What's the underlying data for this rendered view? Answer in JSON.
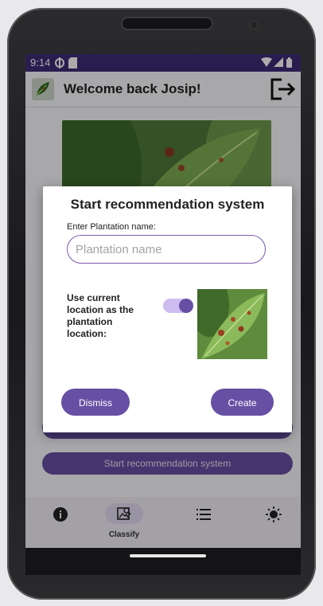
{
  "status_bar": {
    "time": "9:14"
  },
  "app_bar": {
    "title": "Welcome back Josip!"
  },
  "background": {
    "start_button_label": "Start recommendation system"
  },
  "dialog": {
    "title": "Start recommendation system",
    "name_label": "Enter Plantation name:",
    "name_placeholder": "Plantation name",
    "name_value": "",
    "location_label": "Use current location as the plantation location:",
    "location_toggle_on": true,
    "dismiss_label": "Dismiss",
    "create_label": "Create"
  },
  "bottom_nav": {
    "items": [
      {
        "icon": "info-icon",
        "label": ""
      },
      {
        "icon": "image-search-icon",
        "label": "Classify",
        "active": true
      },
      {
        "icon": "list-icon",
        "label": ""
      },
      {
        "icon": "brightness-icon",
        "label": ""
      }
    ]
  },
  "colors": {
    "primary": "#6750a4",
    "status_bar": "#3e2c76",
    "toggle_track": "#cdbcf0"
  }
}
